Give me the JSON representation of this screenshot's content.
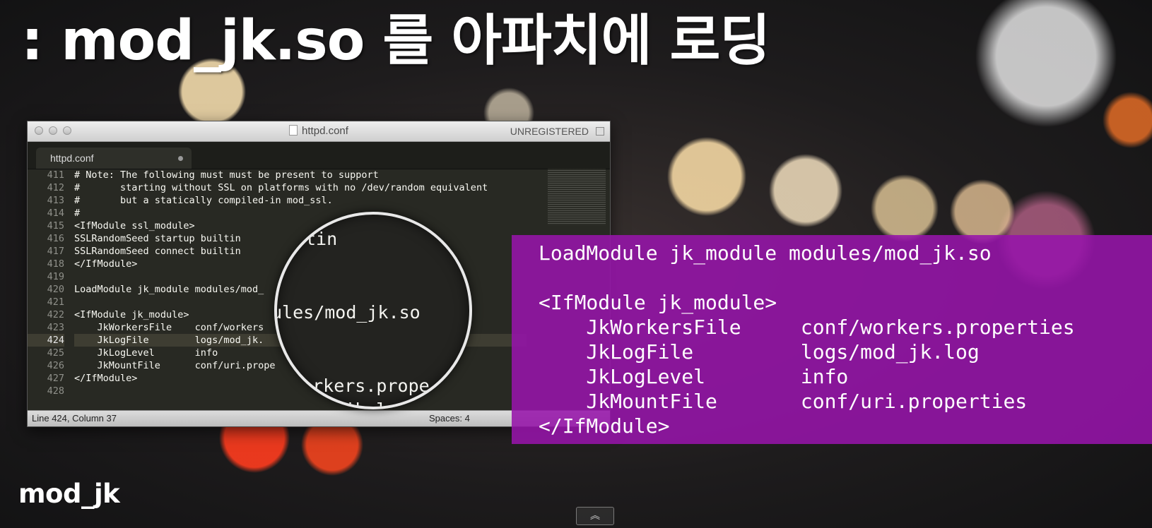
{
  "slide": {
    "headline": ": mod_jk.so 를 아파치에 로딩",
    "brand": "mod_jk"
  },
  "window": {
    "title": "httpd.conf",
    "unregistered": "UNREGISTERED",
    "tab_label": "httpd.conf",
    "status_left": "Line 424, Column 37",
    "status_right": "Spaces: 4",
    "current_line": 424
  },
  "editor": {
    "lines": [
      {
        "num": "411",
        "text": "# Note: The following must must be present to support"
      },
      {
        "num": "412",
        "text": "#       starting without SSL on platforms with no /dev/random equivalent"
      },
      {
        "num": "413",
        "text": "#       but a statically compiled-in mod_ssl."
      },
      {
        "num": "414",
        "text": "#"
      },
      {
        "num": "415",
        "text": "<IfModule ssl_module>"
      },
      {
        "num": "416",
        "text": "SSLRandomSeed startup builtin"
      },
      {
        "num": "417",
        "text": "SSLRandomSeed connect builtin"
      },
      {
        "num": "418",
        "text": "</IfModule>"
      },
      {
        "num": "419",
        "text": ""
      },
      {
        "num": "420",
        "text": "LoadModule jk_module modules/mod_"
      },
      {
        "num": "421",
        "text": ""
      },
      {
        "num": "422",
        "text": "<IfModule jk_module>"
      },
      {
        "num": "423",
        "text": "    JkWorkersFile    conf/workers"
      },
      {
        "num": "424",
        "text": "    JkLogFile        logs/mod_jk."
      },
      {
        "num": "425",
        "text": "    JkLogLevel       info"
      },
      {
        "num": "426",
        "text": "    JkMountFile      conf/uri.prope"
      },
      {
        "num": "427",
        "text": "</IfModule>"
      },
      {
        "num": "428",
        "text": ""
      }
    ]
  },
  "magnifier": {
    "lines": [
      "tin",
      "ules/mod_jk.so",
      "workers.prope",
      "_jk.log"
    ]
  },
  "overlay": {
    "lines": [
      "LoadModule jk_module modules/mod_jk.so",
      "",
      "<IfModule jk_module>",
      "    JkWorkersFile     conf/workers.properties",
      "    JkLogFile         logs/mod_jk.log",
      "    JkLogLevel        info",
      "    JkMountFile       conf/uri.properties",
      "</IfModule>"
    ]
  },
  "controls": {
    "scroll_up_icon": "double-chevron-up-icon",
    "scroll_up_glyph": "︽"
  },
  "colors": {
    "overlay_bg": "#9614aa",
    "editor_bg": "#282923"
  }
}
